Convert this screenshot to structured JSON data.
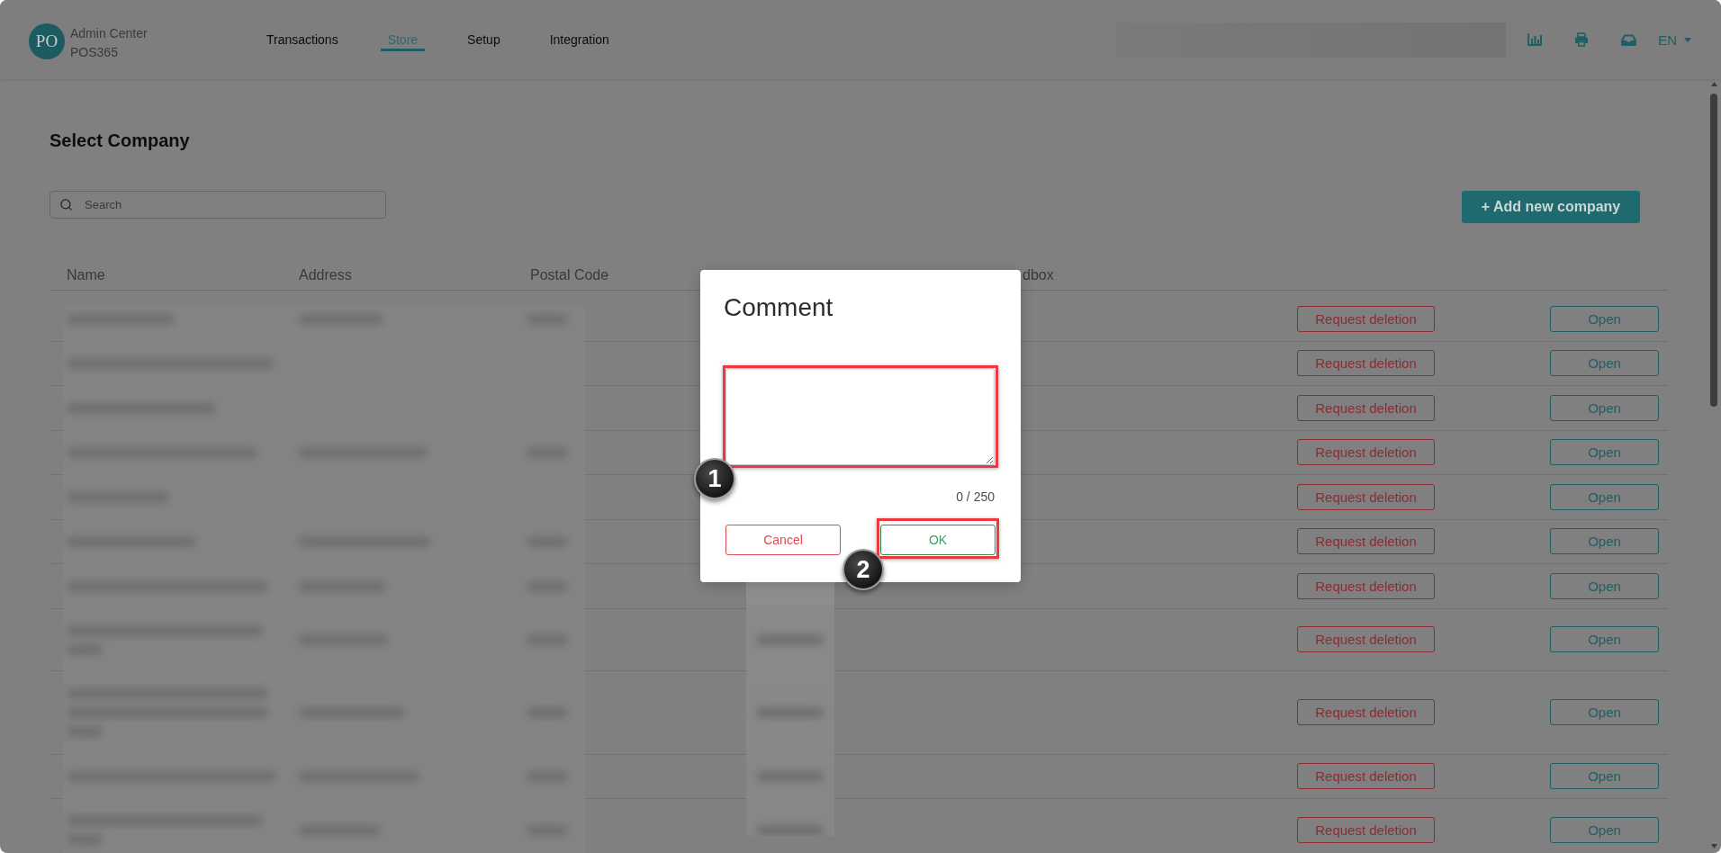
{
  "app": {
    "logo": "PO",
    "title": "Admin Center",
    "subtitle": "POS365"
  },
  "nav": [
    {
      "label": "Transactions",
      "selected": false
    },
    {
      "label": "Store",
      "selected": true
    },
    {
      "label": "Setup",
      "selected": false
    },
    {
      "label": "Integration",
      "selected": false
    }
  ],
  "header": {
    "redacted_box": true,
    "language": "EN"
  },
  "page": {
    "title": "Select Company",
    "search": {
      "placeholder": "Search"
    },
    "add_button": "+ Add new company"
  },
  "table": {
    "columns": [
      "Name",
      "Address",
      "Postal Code",
      "dbox"
    ],
    "left_redacted": true,
    "middle_redacted": true,
    "rows": [
      {
        "kind": "one_line",
        "delete_label": "Request deletion",
        "open_label": "Open"
      },
      {
        "kind": "one_line",
        "delete_label": "Request deletion",
        "open_label": "Open"
      },
      {
        "kind": "one_line",
        "delete_label": "Request deletion",
        "open_label": "Open"
      },
      {
        "kind": "one_line",
        "delete_label": "Request deletion",
        "open_label": "Open"
      },
      {
        "kind": "one_line",
        "delete_label": "Request deletion",
        "open_label": "Open"
      },
      {
        "kind": "one_line",
        "delete_label": "Request deletion",
        "open_label": "Open"
      },
      {
        "kind": "one_line",
        "delete_label": "Request deletion",
        "open_label": "Open"
      },
      {
        "kind": "two_line",
        "delete_label": "Request deletion",
        "open_label": "Open"
      },
      {
        "kind": "three_line",
        "delete_label": "Request deletion",
        "open_label": "Open"
      },
      {
        "kind": "one_line",
        "delete_label": "Request deletion",
        "open_label": "Open"
      },
      {
        "kind": "two_line",
        "delete_label": "Request deletion",
        "open_label": "Open"
      }
    ]
  },
  "dialog": {
    "title": "Comment",
    "comment_field": {
      "highlighted": true,
      "callout": "1"
    },
    "counter": "0 / 250",
    "buttons": [
      {
        "kind": "cancel",
        "label": "Cancel",
        "highlighted": false
      },
      {
        "kind": "confirm",
        "label": "OK",
        "highlighted": true,
        "callout": "2"
      }
    ]
  }
}
